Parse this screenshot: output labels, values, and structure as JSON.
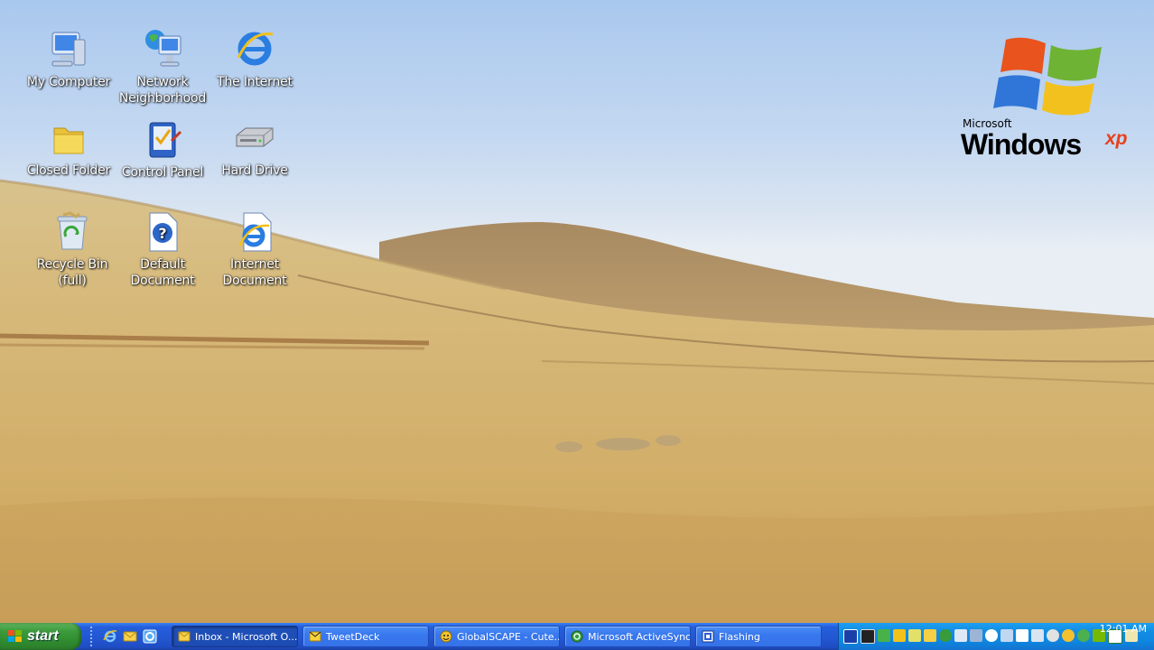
{
  "desktop": {
    "icons": [
      {
        "label": "My Computer",
        "icon": "my-computer-icon"
      },
      {
        "label": "Network\nNeighborhood",
        "icon": "network-neighborhood-icon"
      },
      {
        "label": "The Internet",
        "icon": "internet-explorer-icon"
      },
      {
        "label": "Closed Folder",
        "icon": "folder-icon"
      },
      {
        "label": "Control Panel",
        "icon": "control-panel-icon"
      },
      {
        "label": "Hard Drive",
        "icon": "hard-drive-icon"
      },
      {
        "label": "Recycle Bin\n(full)",
        "icon": "recycle-bin-full-icon"
      },
      {
        "label": "Default\nDocument",
        "icon": "help-document-icon"
      },
      {
        "label": "Internet\nDocument",
        "icon": "internet-document-icon"
      }
    ],
    "logo": {
      "brand": "Microsoft",
      "name": "Windows",
      "suffix": "xp"
    }
  },
  "taskbar": {
    "start_label": "start",
    "quick_launch": [
      "internet-explorer-icon",
      "outlook-icon",
      "ie-blue-icon"
    ],
    "tasks": [
      {
        "label": "Inbox - Microsoft O...",
        "icon": "outlook-icon",
        "active": true
      },
      {
        "label": "TweetDeck",
        "icon": "tweetdeck-icon",
        "active": false
      },
      {
        "label": "GlobalSCAPE - Cute...",
        "icon": "cuteftp-icon",
        "active": false
      },
      {
        "label": "Microsoft ActiveSync",
        "icon": "activesync-icon",
        "active": false
      },
      {
        "label": "Flashing",
        "icon": "flashing-icon",
        "active": false
      }
    ],
    "clock": "12:01 AM"
  },
  "colors": {
    "taskbar_blue": "#245edc",
    "start_green": "#3c9b3c",
    "tray_blue": "#0f85df",
    "sky": "#c4d8f1",
    "grass": "#d2b06a"
  }
}
